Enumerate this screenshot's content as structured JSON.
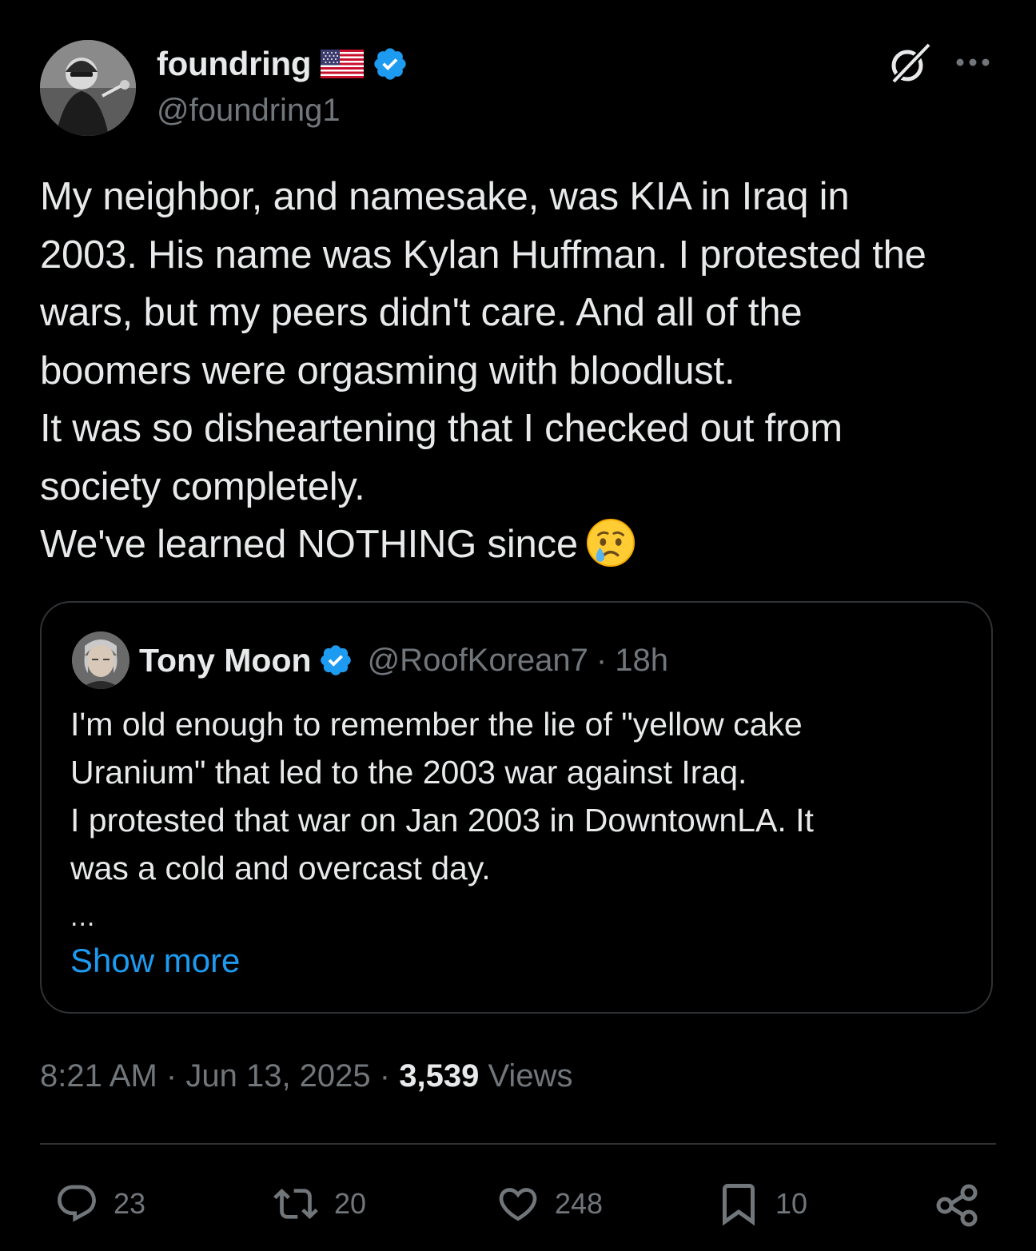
{
  "author": {
    "display_name": "foundring",
    "flag_icon": "us-flag-icon",
    "handle": "@foundring1",
    "verified": true
  },
  "tweet": {
    "lines": [
      "My neighbor, and namesake, was KIA in Iraq in",
      "2003. His name was Kylan Huffman. I protested the",
      "wars, but my peers didn't care. And all of the",
      "boomers were orgasming with bloodlust.",
      "It was so disheartening that I checked out from",
      "society completely.",
      "We've learned NOTHING since"
    ],
    "trailing_emoji": "crying-face-icon"
  },
  "quote": {
    "display_name": "Tony Moon",
    "handle": "@RoofKorean7",
    "separator": "·",
    "time": "18h",
    "lines": [
      "I'm old enough to remember the lie of \"yellow cake",
      "Uranium\" that led to the 2003 war against Iraq.",
      "I protested that war on Jan 2003 in DowntownLA. It",
      "was a cold and overcast day."
    ],
    "ellipsis": "...",
    "show_more": "Show more"
  },
  "meta": {
    "time": "8:21 AM",
    "sep1": "·",
    "date": "Jun 13, 2025",
    "sep2": "·",
    "views_count": "3,539",
    "views_label": "Views"
  },
  "actions": {
    "replies": "23",
    "reposts": "20",
    "likes": "248",
    "bookmarks": "10"
  },
  "colors": {
    "background": "#000000",
    "text_primary": "#e7e9ea",
    "text_secondary": "#71767b",
    "accent": "#1d9bf0",
    "border": "#2f3336"
  }
}
